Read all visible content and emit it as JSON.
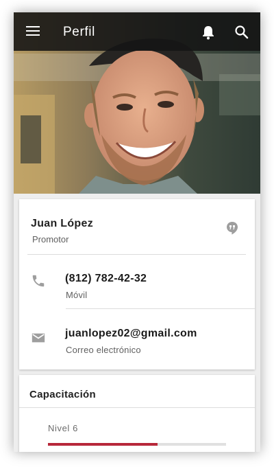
{
  "appbar": {
    "title": "Perfil",
    "menu_icon": "menu-icon",
    "notifications_icon": "bell-icon",
    "search_icon": "search-icon"
  },
  "profile": {
    "name": "Juan López",
    "role": "Promotor",
    "hangouts_icon": "hangouts-icon"
  },
  "contacts": [
    {
      "icon": "phone-icon",
      "value": "(812) 782-42-32",
      "label": "Móvil"
    },
    {
      "icon": "mail-icon",
      "value": "juanlopez02@gmail.com",
      "label": "Correo electrónico"
    }
  ],
  "training": {
    "title": "Capacitación",
    "level_label": "Nivel 6",
    "progress": 0.615
  },
  "colors": {
    "appbar": "#141414",
    "accent": "#b7283a",
    "icon_gray": "#9e9e9e"
  }
}
